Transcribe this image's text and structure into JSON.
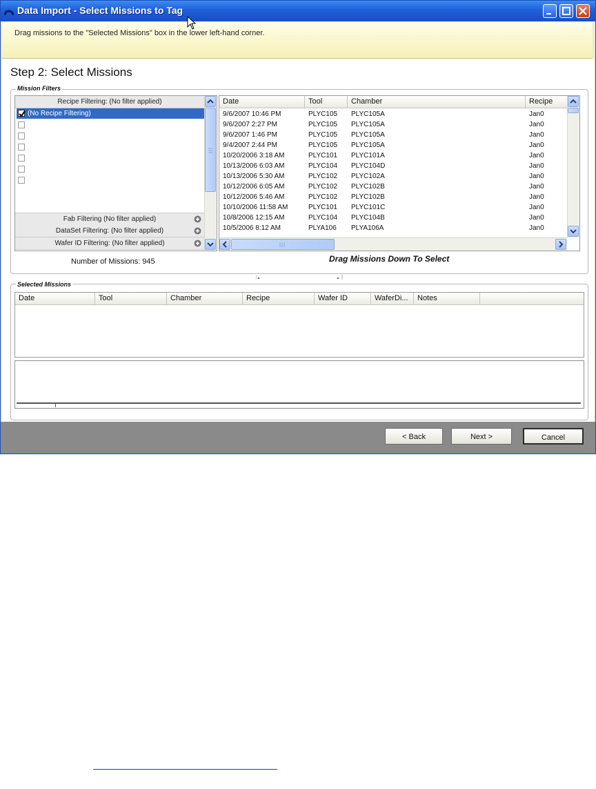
{
  "window": {
    "title": "Data Import - Select Missions to Tag",
    "banner_text": "Drag missions to the \"Selected Missions\" box in the lower left-hand corner."
  },
  "step_title": "Step 2: Select Missions",
  "mission_filters": {
    "label": "Mission Filters",
    "recipe_filter_header": "Recipe Filtering: (No filter applied)",
    "recipe_items": [
      {
        "label": "(No Recipe Filtering)",
        "checked": true,
        "selected": true
      },
      {
        "label": "",
        "checked": false
      },
      {
        "label": "",
        "checked": false
      },
      {
        "label": "",
        "checked": false
      },
      {
        "label": "",
        "checked": false
      },
      {
        "label": "",
        "checked": false
      },
      {
        "label": "",
        "checked": false
      }
    ],
    "other_filters": [
      "Fab Filtering (No filter applied)",
      "DataSet Filtering: (No filter applied)",
      "Wafer ID Filtering: (No filter applied)"
    ],
    "mission_count_text": "Number of Missions: 945"
  },
  "missions_grid": {
    "columns": [
      "Date",
      "Tool",
      "Chamber",
      "Recipe"
    ],
    "rows": [
      [
        "9/6/2007 10:46 PM",
        "PLYC105",
        "PLYC105A",
        "Jan0"
      ],
      [
        "9/6/2007 2:27 PM",
        "PLYC105",
        "PLYC105A",
        "Jan0"
      ],
      [
        "9/6/2007 1:46 PM",
        "PLYC105",
        "PLYC105A",
        "Jan0"
      ],
      [
        "9/4/2007 2:44 PM",
        "PLYC105",
        "PLYC105A",
        "Jan0"
      ],
      [
        "10/20/2006 3:18 AM",
        "PLYC101",
        "PLYC101A",
        "Jan0"
      ],
      [
        "10/13/2006 6:03 AM",
        "PLYC104",
        "PLYC104D",
        "Jan0"
      ],
      [
        "10/13/2006 5:30 AM",
        "PLYC102",
        "PLYC102A",
        "Jan0"
      ],
      [
        "10/12/2006 6:05 AM",
        "PLYC102",
        "PLYC102B",
        "Jan0"
      ],
      [
        "10/12/2006 5:46 AM",
        "PLYC102",
        "PLYC102B",
        "Jan0"
      ],
      [
        "10/10/2006 11:58 AM",
        "PLYC101",
        "PLYC101C",
        "Jan0"
      ],
      [
        "10/8/2006 12:15 AM",
        "PLYC104",
        "PLYC104B",
        "Jan0"
      ],
      [
        "10/5/2006 8:12 AM",
        "PLYA106",
        "PLYA106A",
        "Jan0"
      ]
    ],
    "drag_hint": "Drag Missions Down To Select"
  },
  "selected_missions": {
    "label": "Selected Missions",
    "columns": [
      "Date",
      "Tool",
      "Chamber",
      "Recipe",
      "Wafer ID",
      "WaferDi...",
      "Notes"
    ]
  },
  "buttons": {
    "back": "< Back",
    "next": "Next >",
    "cancel": "Cancel"
  }
}
